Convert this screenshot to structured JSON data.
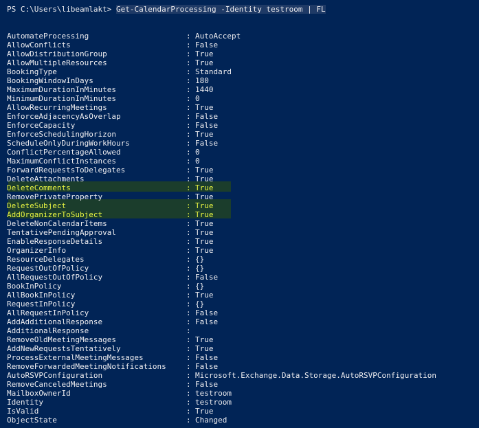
{
  "prompt": {
    "path": "PS C:\\Users\\libeamlakt> ",
    "command": "Get-CalendarProcessing -Identity testroom | FL"
  },
  "colors": {
    "background": "#012456",
    "text": "#eeedf0",
    "highlight_text": "#e9f542",
    "highlight_bg": "#1b3d2c"
  },
  "rows": [
    {
      "key": "AutomateProcessing",
      "value": "AutoAccept",
      "highlight": false
    },
    {
      "key": "AllowConflicts",
      "value": "False",
      "highlight": false
    },
    {
      "key": "AllowDistributionGroup",
      "value": "True",
      "highlight": false
    },
    {
      "key": "AllowMultipleResources",
      "value": "True",
      "highlight": false
    },
    {
      "key": "BookingType",
      "value": "Standard",
      "highlight": false
    },
    {
      "key": "BookingWindowInDays",
      "value": "180",
      "highlight": false
    },
    {
      "key": "MaximumDurationInMinutes",
      "value": "1440",
      "highlight": false
    },
    {
      "key": "MinimumDurationInMinutes",
      "value": "0",
      "highlight": false
    },
    {
      "key": "AllowRecurringMeetings",
      "value": "True",
      "highlight": false
    },
    {
      "key": "EnforceAdjacencyAsOverlap",
      "value": "False",
      "highlight": false
    },
    {
      "key": "EnforceCapacity",
      "value": "False",
      "highlight": false
    },
    {
      "key": "EnforceSchedulingHorizon",
      "value": "True",
      "highlight": false
    },
    {
      "key": "ScheduleOnlyDuringWorkHours",
      "value": "False",
      "highlight": false
    },
    {
      "key": "ConflictPercentageAllowed",
      "value": "0",
      "highlight": false
    },
    {
      "key": "MaximumConflictInstances",
      "value": "0",
      "highlight": false
    },
    {
      "key": "ForwardRequestsToDelegates",
      "value": "True",
      "highlight": false
    },
    {
      "key": "DeleteAttachments",
      "value": "True",
      "highlight": false
    },
    {
      "key": "DeleteComments",
      "value": "True",
      "highlight": true
    },
    {
      "key": "RemovePrivateProperty",
      "value": "True",
      "highlight": false
    },
    {
      "key": "DeleteSubject",
      "value": "True",
      "highlight": true
    },
    {
      "key": "AddOrganizerToSubject",
      "value": "True",
      "highlight": true
    },
    {
      "key": "DeleteNonCalendarItems",
      "value": "True",
      "highlight": false
    },
    {
      "key": "TentativePendingApproval",
      "value": "True",
      "highlight": false
    },
    {
      "key": "EnableResponseDetails",
      "value": "True",
      "highlight": false
    },
    {
      "key": "OrganizerInfo",
      "value": "True",
      "highlight": false
    },
    {
      "key": "ResourceDelegates",
      "value": "{}",
      "highlight": false
    },
    {
      "key": "RequestOutOfPolicy",
      "value": "{}",
      "highlight": false
    },
    {
      "key": "AllRequestOutOfPolicy",
      "value": "False",
      "highlight": false
    },
    {
      "key": "BookInPolicy",
      "value": "{}",
      "highlight": false
    },
    {
      "key": "AllBookInPolicy",
      "value": "True",
      "highlight": false
    },
    {
      "key": "RequestInPolicy",
      "value": "{}",
      "highlight": false
    },
    {
      "key": "AllRequestInPolicy",
      "value": "False",
      "highlight": false
    },
    {
      "key": "AddAdditionalResponse",
      "value": "False",
      "highlight": false
    },
    {
      "key": "AdditionalResponse",
      "value": "",
      "highlight": false
    },
    {
      "key": "RemoveOldMeetingMessages",
      "value": "True",
      "highlight": false
    },
    {
      "key": "AddNewRequestsTentatively",
      "value": "True",
      "highlight": false
    },
    {
      "key": "ProcessExternalMeetingMessages",
      "value": "False",
      "highlight": false
    },
    {
      "key": "RemoveForwardedMeetingNotifications",
      "value": "False",
      "highlight": false
    },
    {
      "key": "AutoRSVPConfiguration",
      "value": "Microsoft.Exchange.Data.Storage.AutoRSVPConfiguration",
      "highlight": false
    },
    {
      "key": "RemoveCanceledMeetings",
      "value": "False",
      "highlight": false
    },
    {
      "key": "MailboxOwnerId",
      "value": "testroom",
      "highlight": false
    },
    {
      "key": "Identity",
      "value": "testroom",
      "highlight": false
    },
    {
      "key": "IsValid",
      "value": "True",
      "highlight": false
    },
    {
      "key": "ObjectState",
      "value": "Changed",
      "highlight": false
    }
  ]
}
